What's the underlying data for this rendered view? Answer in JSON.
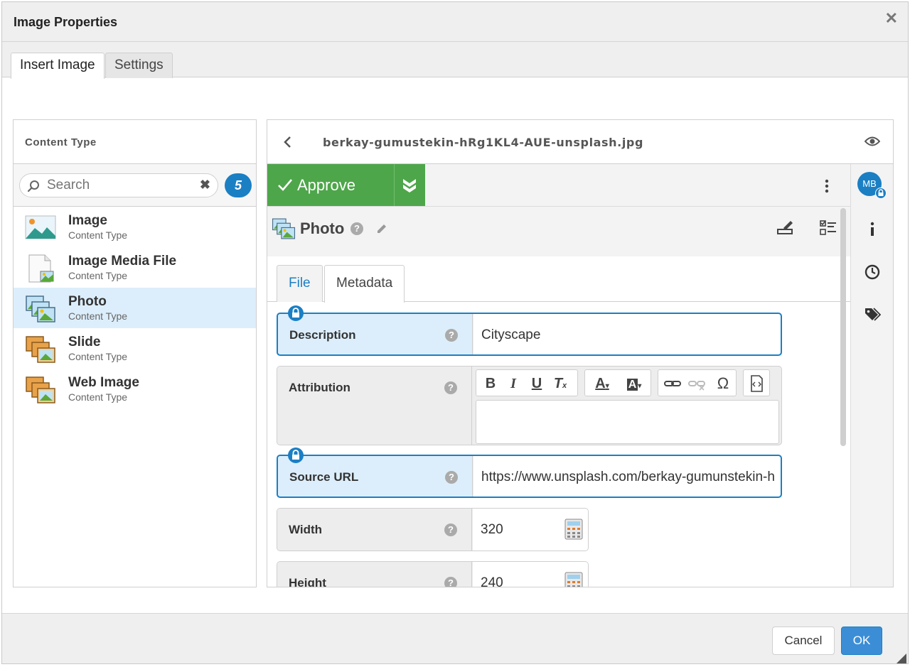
{
  "dialog": {
    "title": "Image Properties",
    "close_glyph": "✕"
  },
  "top_tabs": [
    {
      "label": "Insert Image",
      "active": true
    },
    {
      "label": "Settings",
      "active": false
    }
  ],
  "content_type_panel": {
    "title": "Content Type",
    "search": {
      "placeholder": "Search",
      "value": ""
    },
    "count": "5",
    "items": [
      {
        "name": "Image",
        "subtitle": "Content Type",
        "icon": "image-landscape-icon",
        "selected": false
      },
      {
        "name": "Image Media File",
        "subtitle": "Content Type",
        "icon": "image-file-icon",
        "selected": false
      },
      {
        "name": "Photo",
        "subtitle": "Content Type",
        "icon": "photo-stack-icon",
        "selected": true
      },
      {
        "name": "Slide",
        "subtitle": "Content Type",
        "icon": "slide-stack-icon",
        "selected": false
      },
      {
        "name": "Web Image",
        "subtitle": "Content Type",
        "icon": "web-image-stack-icon",
        "selected": false
      }
    ]
  },
  "detail_panel": {
    "file_name": "berkay-gumustekin-hRg1KL4-AUE-unsplash.jpg",
    "approve_label": "Approve",
    "avatar_initials": "MB",
    "content_type": "Photo",
    "inner_tabs": [
      {
        "label": "File",
        "active": false
      },
      {
        "label": "Metadata",
        "active": true
      }
    ],
    "fields": {
      "description": {
        "label": "Description",
        "value": "Cityscape"
      },
      "attribution": {
        "label": "Attribution",
        "value": ""
      },
      "source_url": {
        "label": "Source URL",
        "value": "https://www.unsplash.com/berkay-gumunstekin-h"
      },
      "width": {
        "label": "Width",
        "value": "320"
      },
      "height": {
        "label": "Height",
        "value": "240"
      }
    }
  },
  "footer": {
    "cancel_label": "Cancel",
    "ok_label": "OK"
  },
  "colors": {
    "accent": "#1b7fc4",
    "approve": "#4ea64a",
    "selected_bg": "#dceefb"
  }
}
